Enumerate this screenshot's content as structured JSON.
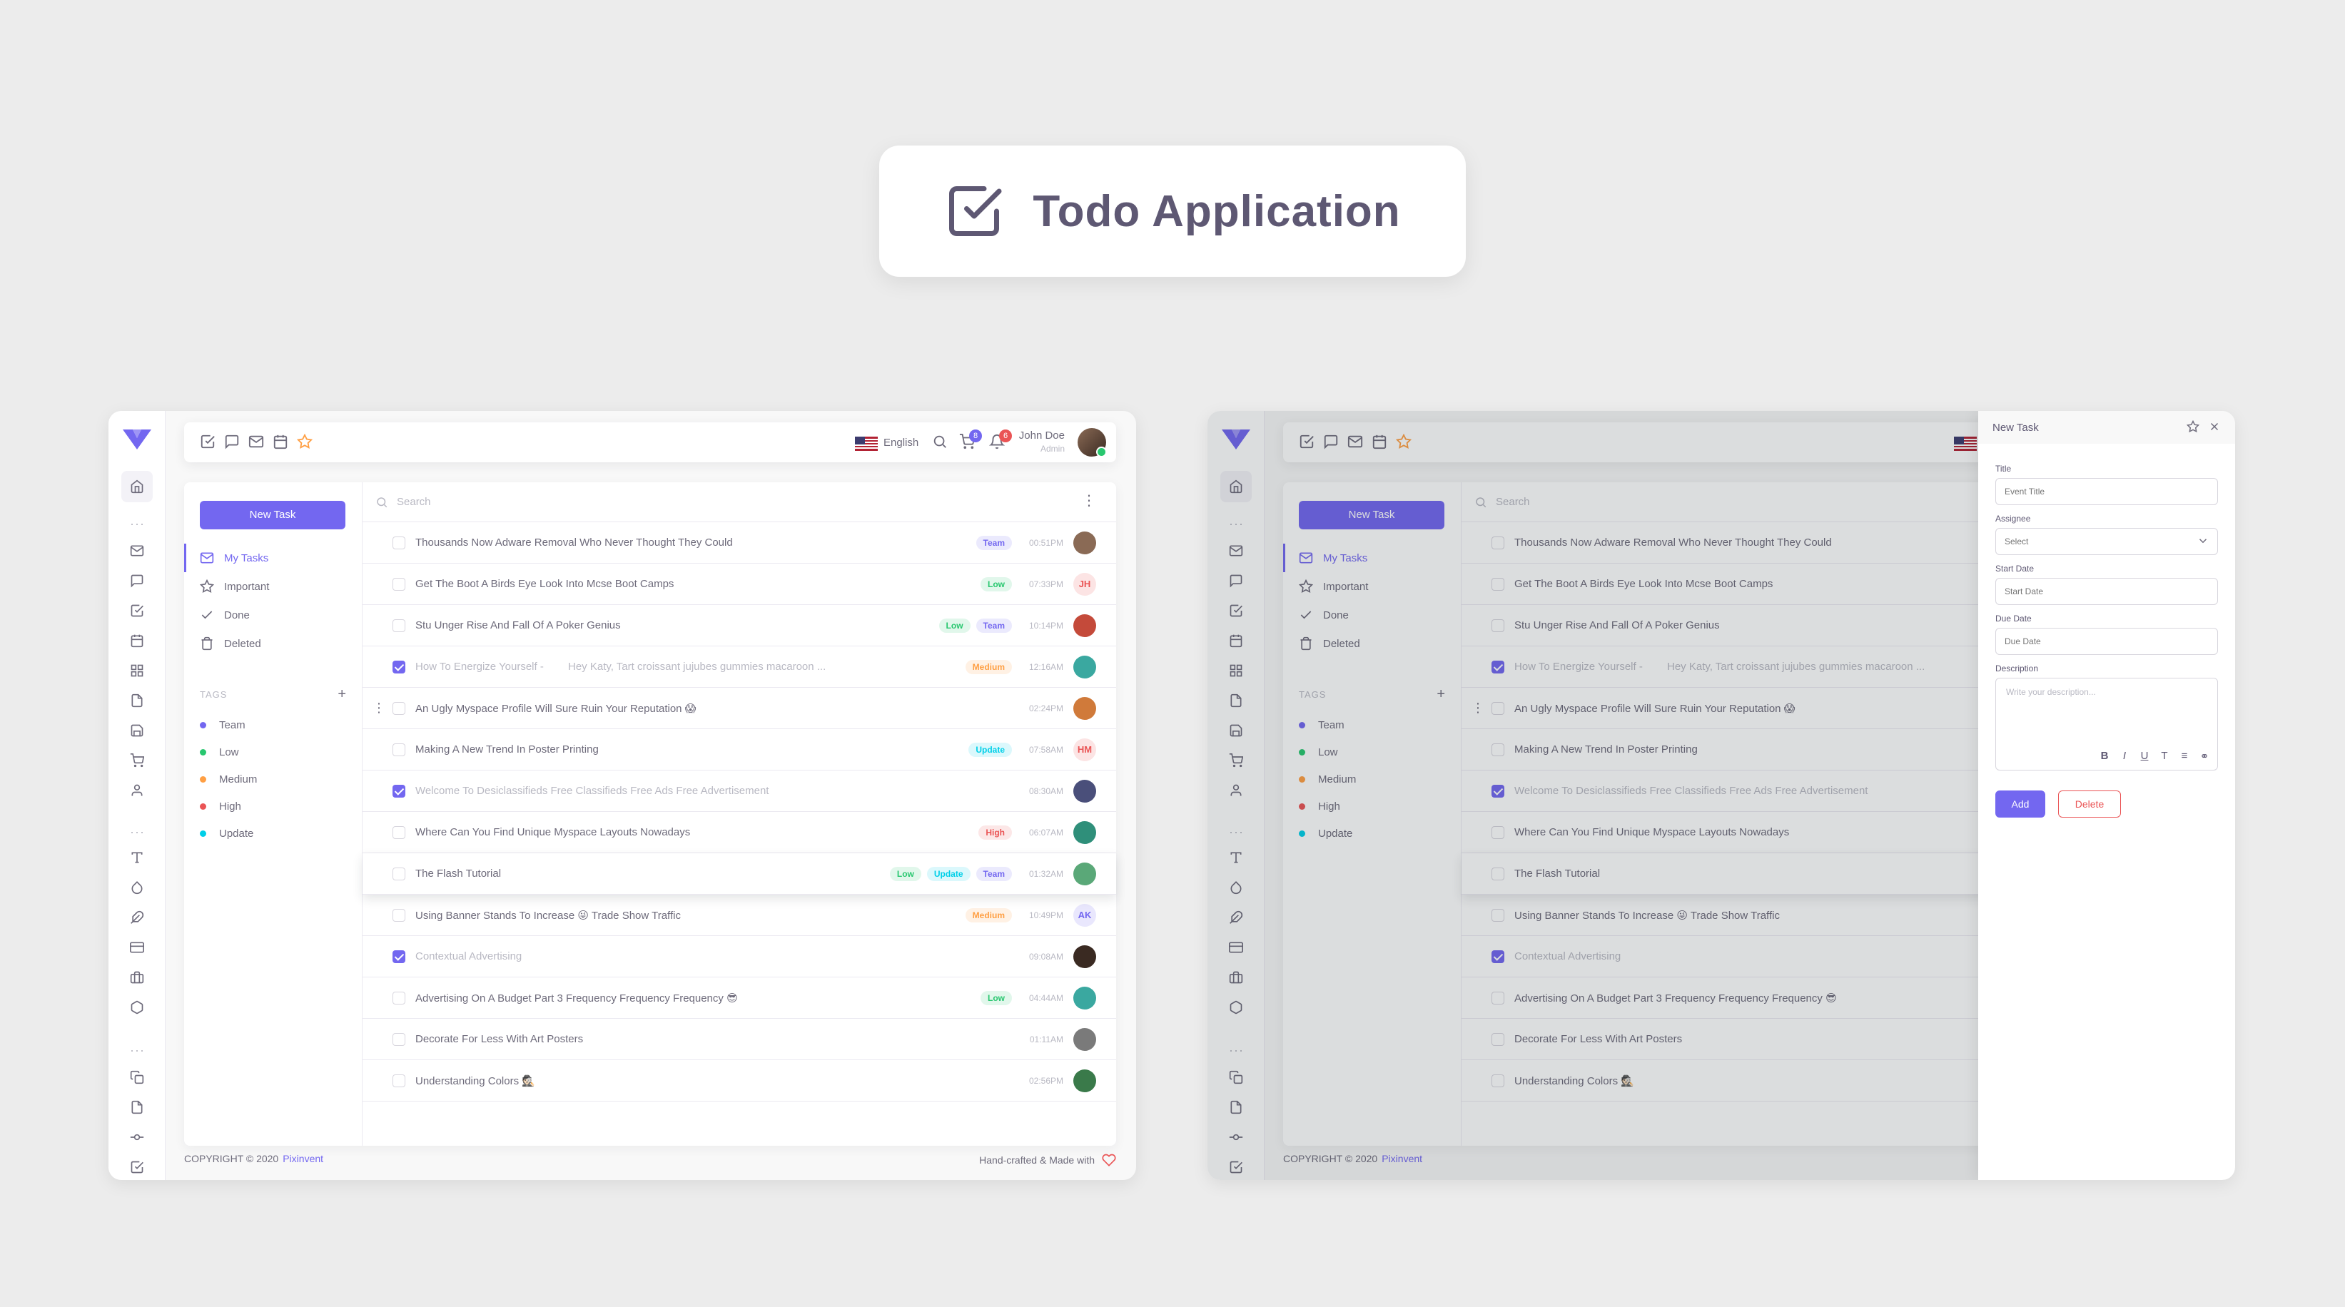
{
  "hero": {
    "title": "Todo Application",
    "icon": "checkbox-icon"
  },
  "navbar": {
    "language": "English",
    "cart_count": "8",
    "notif_count": "6",
    "user_name": "John Doe",
    "user_role": "Admin"
  },
  "sidebar": {
    "new_task": "New Task",
    "filters": [
      {
        "label": "My Tasks",
        "icon": "mail-icon"
      },
      {
        "label": "Important",
        "icon": "star-icon"
      },
      {
        "label": "Done",
        "icon": "check-icon"
      },
      {
        "label": "Deleted",
        "icon": "trash-icon"
      }
    ],
    "tags_header": "TAGS",
    "tags": [
      {
        "label": "Team",
        "color": "#7367f0"
      },
      {
        "label": "Low",
        "color": "#28c76f"
      },
      {
        "label": "Medium",
        "color": "#ff9f43"
      },
      {
        "label": "High",
        "color": "#ea5455"
      },
      {
        "label": "Update",
        "color": "#00cfe8"
      }
    ]
  },
  "list": {
    "search_placeholder": "Search",
    "tasks": [
      {
        "title": "Thousands Now Adware Removal Who Never Thought They Could",
        "sub": "",
        "tags": [
          "Team"
        ],
        "date": "00:51PM",
        "done": false,
        "avatar": "",
        "avatar_color": "#8a6a55"
      },
      {
        "title": "Get The Boot A Birds Eye Look Into Mcse Boot Camps",
        "sub": "",
        "tags": [
          "Low"
        ],
        "date": "07:33PM",
        "done": false,
        "avatar": "JH",
        "avatar_color": "#fce4e4"
      },
      {
        "title": "Stu Unger Rise And Fall Of A Poker Genius",
        "sub": "",
        "tags": [
          "Low",
          "Team"
        ],
        "date": "10:14PM",
        "done": false,
        "avatar": "",
        "avatar_color": "#c44a3a"
      },
      {
        "title": "How To Energize Yourself -",
        "sub": "Hey Katy, Tart croissant jujubes gummies macaroon ...",
        "tags": [
          "Medium"
        ],
        "date": "12:16AM",
        "done": true,
        "avatar": "",
        "avatar_color": "#3aa8a0"
      },
      {
        "title": "An Ugly Myspace Profile Will Sure Ruin Your Reputation 😱",
        "sub": "",
        "tags": [],
        "date": "02:24PM",
        "done": false,
        "avatar": "",
        "avatar_color": "#d07a3a"
      },
      {
        "title": "Making A New Trend In Poster Printing",
        "sub": "",
        "tags": [
          "Update"
        ],
        "date": "07:58AM",
        "done": false,
        "avatar": "HM",
        "avatar_color": "#fce4e4"
      },
      {
        "title": "Welcome To Desiclassifieds Free Classifieds Free Ads Free Advertisement",
        "sub": "",
        "tags": [],
        "date": "08:30AM",
        "done": true,
        "avatar": "",
        "avatar_color": "#4a4f7a"
      },
      {
        "title": "Where Can You Find Unique Myspace Layouts Nowadays",
        "sub": "",
        "tags": [
          "High"
        ],
        "date": "06:07AM",
        "done": false,
        "avatar": "",
        "avatar_color": "#2f8f7a"
      },
      {
        "title": "The Flash Tutorial",
        "sub": "",
        "tags": [
          "Low",
          "Update",
          "Team"
        ],
        "date": "01:32AM",
        "done": false,
        "avatar": "",
        "avatar_color": "#5aa878"
      },
      {
        "title": "Using Banner Stands To Increase 😜 Trade Show Traffic",
        "sub": "",
        "tags": [
          "Medium"
        ],
        "date": "10:49PM",
        "done": false,
        "avatar": "AK",
        "avatar_color": "#e9e7fd"
      },
      {
        "title": "Contextual Advertising",
        "sub": "",
        "tags": [],
        "date": "09:08AM",
        "done": true,
        "avatar": "",
        "avatar_color": "#3a2a22"
      },
      {
        "title": "Advertising On A Budget Part 3 Frequency Frequency Frequency 😎",
        "sub": "",
        "tags": [
          "Low"
        ],
        "date": "04:44AM",
        "done": false,
        "avatar": "",
        "avatar_color": "#3aa8a0"
      },
      {
        "title": "Decorate For Less With Art Posters",
        "sub": "",
        "tags": [],
        "date": "01:11AM",
        "done": false,
        "avatar": "",
        "avatar_color": "#7a7a7a"
      },
      {
        "title": "Understanding Colors 🕵🏻",
        "sub": "",
        "tags": [],
        "date": "02:56PM",
        "done": false,
        "avatar": "",
        "avatar_color": "#3a7a4a"
      }
    ]
  },
  "footer": {
    "copyright": "COPYRIGHT © 2020",
    "brand": "Pixinvent",
    "right": "Hand-crafted & Made with"
  },
  "modal": {
    "header": "New Task",
    "title_label": "Title",
    "title_placeholder": "Event Title",
    "assignee_label": "Assignee",
    "assignee_placeholder": "Select",
    "start_label": "Start Date",
    "start_placeholder": "Start Date",
    "due_label": "Due Date",
    "due_placeholder": "Due Date",
    "desc_label": "Description",
    "desc_placeholder": "Write your description...",
    "add": "Add",
    "delete": "Delete"
  }
}
